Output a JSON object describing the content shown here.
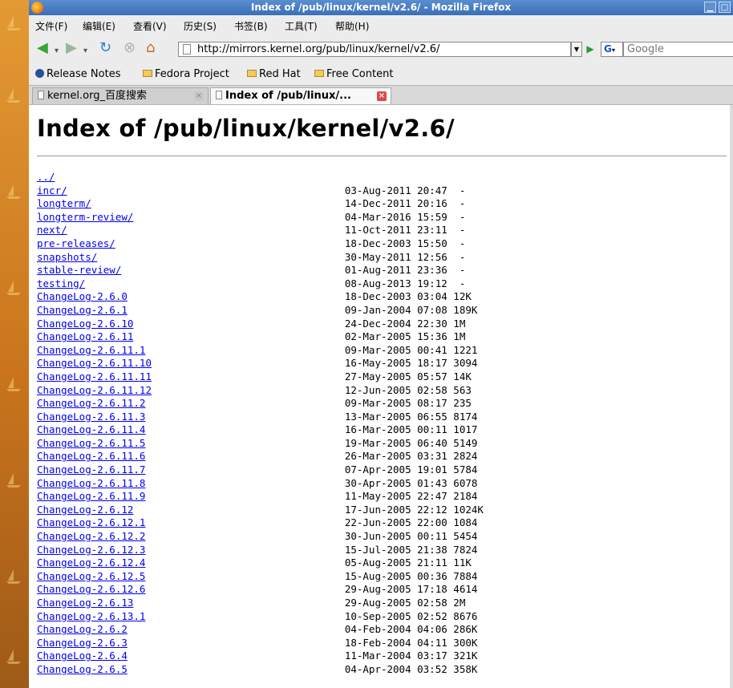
{
  "window": {
    "title": "Index of /pub/linux/kernel/v2.6/ - Mozilla Firefox"
  },
  "menu": [
    "文件(F)",
    "编辑(E)",
    "查看(V)",
    "历史(S)",
    "书签(B)",
    "工具(T)",
    "帮助(H)"
  ],
  "nav": {
    "url": "http://mirrors.kernel.org/pub/linux/kernel/v2.6/",
    "search_placeholder": "Google",
    "search_engine": "G"
  },
  "bookmarks": [
    "Release Notes",
    "Fedora Project",
    "Red Hat",
    "Free Content"
  ],
  "tabs": [
    {
      "label": "kernel.org_百度搜索"
    },
    {
      "label": "Index of /pub/linux/..."
    }
  ],
  "page": {
    "heading": "Index of /pub/linux/kernel/v2.6/",
    "rows": [
      {
        "name": "../",
        "date": "",
        "size": ""
      },
      {
        "name": "incr/",
        "date": "03-Aug-2011 20:47",
        "size": "-"
      },
      {
        "name": "longterm/",
        "date": "14-Dec-2011 20:16",
        "size": "-"
      },
      {
        "name": "longterm-review/",
        "date": "04-Mar-2016 15:59",
        "size": "-"
      },
      {
        "name": "next/",
        "date": "11-Oct-2011 23:11",
        "size": "-"
      },
      {
        "name": "pre-releases/",
        "date": "18-Dec-2003 15:50",
        "size": "-"
      },
      {
        "name": "snapshots/",
        "date": "30-May-2011 12:56",
        "size": "-"
      },
      {
        "name": "stable-review/",
        "date": "01-Aug-2011 23:36",
        "size": "-"
      },
      {
        "name": "testing/",
        "date": "08-Aug-2013 19:12",
        "size": "-"
      },
      {
        "name": "ChangeLog-2.6.0",
        "date": "18-Dec-2003 03:04",
        "size": "12K"
      },
      {
        "name": "ChangeLog-2.6.1",
        "date": "09-Jan-2004 07:08",
        "size": "189K"
      },
      {
        "name": "ChangeLog-2.6.10",
        "date": "24-Dec-2004 22:30",
        "size": "1M"
      },
      {
        "name": "ChangeLog-2.6.11",
        "date": "02-Mar-2005 15:36",
        "size": "1M"
      },
      {
        "name": "ChangeLog-2.6.11.1",
        "date": "09-Mar-2005 00:41",
        "size": "1221"
      },
      {
        "name": "ChangeLog-2.6.11.10",
        "date": "16-May-2005 18:17",
        "size": "3094"
      },
      {
        "name": "ChangeLog-2.6.11.11",
        "date": "27-May-2005 05:57",
        "size": "14K"
      },
      {
        "name": "ChangeLog-2.6.11.12",
        "date": "12-Jun-2005 02:58",
        "size": "563"
      },
      {
        "name": "ChangeLog-2.6.11.2",
        "date": "09-Mar-2005 08:17",
        "size": "235"
      },
      {
        "name": "ChangeLog-2.6.11.3",
        "date": "13-Mar-2005 06:55",
        "size": "8174"
      },
      {
        "name": "ChangeLog-2.6.11.4",
        "date": "16-Mar-2005 00:11",
        "size": "1017"
      },
      {
        "name": "ChangeLog-2.6.11.5",
        "date": "19-Mar-2005 06:40",
        "size": "5149"
      },
      {
        "name": "ChangeLog-2.6.11.6",
        "date": "26-Mar-2005 03:31",
        "size": "2824"
      },
      {
        "name": "ChangeLog-2.6.11.7",
        "date": "07-Apr-2005 19:01",
        "size": "5784"
      },
      {
        "name": "ChangeLog-2.6.11.8",
        "date": "30-Apr-2005 01:43",
        "size": "6078"
      },
      {
        "name": "ChangeLog-2.6.11.9",
        "date": "11-May-2005 22:47",
        "size": "2184"
      },
      {
        "name": "ChangeLog-2.6.12",
        "date": "17-Jun-2005 22:12",
        "size": "1024K"
      },
      {
        "name": "ChangeLog-2.6.12.1",
        "date": "22-Jun-2005 22:00",
        "size": "1084"
      },
      {
        "name": "ChangeLog-2.6.12.2",
        "date": "30-Jun-2005 00:11",
        "size": "5454"
      },
      {
        "name": "ChangeLog-2.6.12.3",
        "date": "15-Jul-2005 21:38",
        "size": "7824"
      },
      {
        "name": "ChangeLog-2.6.12.4",
        "date": "05-Aug-2005 21:11",
        "size": "11K"
      },
      {
        "name": "ChangeLog-2.6.12.5",
        "date": "15-Aug-2005 00:36",
        "size": "7884"
      },
      {
        "name": "ChangeLog-2.6.12.6",
        "date": "29-Aug-2005 17:18",
        "size": "4614"
      },
      {
        "name": "ChangeLog-2.6.13",
        "date": "29-Aug-2005 02:58",
        "size": "2M"
      },
      {
        "name": "ChangeLog-2.6.13.1",
        "date": "10-Sep-2005 02:52",
        "size": "8676"
      },
      {
        "name": "ChangeLog-2.6.2",
        "date": "04-Feb-2004 04:06",
        "size": "286K"
      },
      {
        "name": "ChangeLog-2.6.3",
        "date": "18-Feb-2004 04:11",
        "size": "300K"
      },
      {
        "name": "ChangeLog-2.6.4",
        "date": "11-Mar-2004 03:17",
        "size": "321K"
      },
      {
        "name": "ChangeLog-2.6.5",
        "date": "04-Apr-2004 03:52",
        "size": "358K"
      }
    ]
  }
}
